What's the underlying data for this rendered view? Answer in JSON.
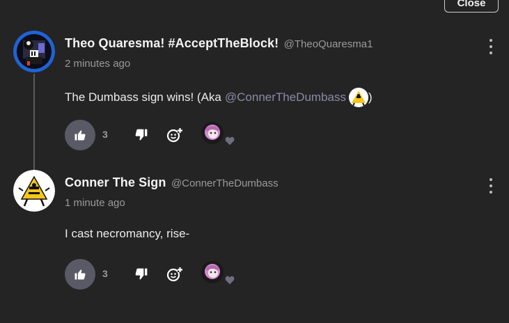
{
  "header": {
    "close_label": "Close"
  },
  "comments": [
    {
      "display_name": "Theo Quaresma! #AcceptTheBlock!",
      "handle": "@TheoQuaresma1",
      "timestamp": "2 minutes ago",
      "body_text": "The Dumbass sign wins! (Aka",
      "mention": "@ConnerTheDumbass",
      "body_suffix": ")",
      "like_count": "3",
      "avatar_icon": "pixel-character-avatar",
      "reactor_icon": "pink-hair-avatar"
    },
    {
      "display_name": "Conner The Sign",
      "handle": "@ConnerTheDumbass",
      "timestamp": "1 minute ago",
      "body_text": "I cast necromancy, rise-",
      "like_count": "3",
      "avatar_icon": "yellow-triangle-sign-avatar",
      "reactor_icon": "pink-hair-avatar"
    }
  ],
  "colors": {
    "background": "#242424",
    "like_button": "#5a5a66",
    "mention": "#8a8aa8",
    "muted_text": "#9a9a9a"
  }
}
